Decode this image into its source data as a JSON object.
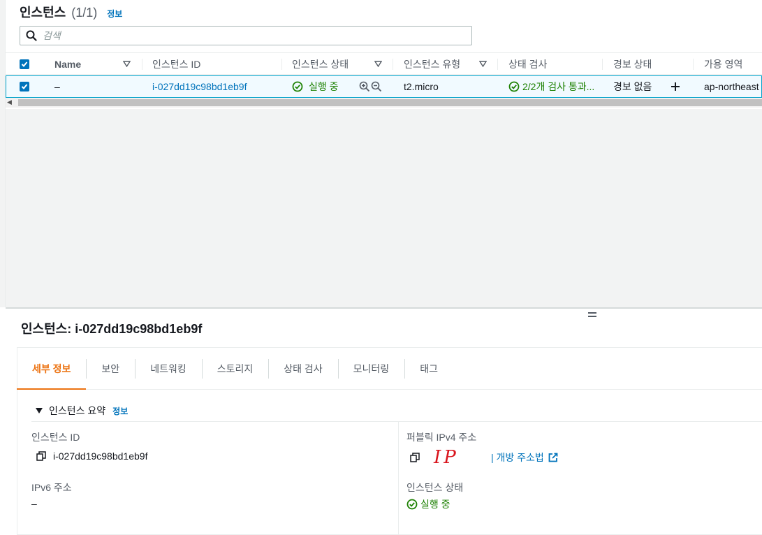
{
  "header": {
    "title": "인스턴스",
    "count": "(1/1)",
    "info": "정보"
  },
  "search": {
    "placeholder": "검색"
  },
  "table": {
    "columns": [
      "Name",
      "인스턴스 ID",
      "인스턴스 상태",
      "인스턴스 유형",
      "상태 검사",
      "경보 상태",
      "가용 영역"
    ],
    "row": {
      "name": "–",
      "instance_id": "i-027dd19c98bd1eb9f",
      "state": "실행 중",
      "type": "t2.micro",
      "status_check": "2/2개 검사 통과...",
      "alarm": "경보 없음",
      "az": "ap-northeast"
    }
  },
  "detail": {
    "title": "인스턴스: i-027dd19c98bd1eb9f",
    "tabs": [
      "세부 정보",
      "보안",
      "네트워킹",
      "스토리지",
      "상태 검사",
      "모니터링",
      "태그"
    ],
    "section_title": "인스턴스 요약",
    "section_info": "정보",
    "fields": {
      "instance_id_label": "인스턴스 ID",
      "instance_id_value": "i-027dd19c98bd1eb9f",
      "public_ip_label": "퍼블릭 IPv4 주소",
      "public_ip_value": "IP",
      "open_address": "| 개방 주소법",
      "ipv6_label": "IPv6 주소",
      "ipv6_value": "–",
      "state_label": "인스턴스 상태",
      "state_value": "실행 중"
    }
  },
  "colors": {
    "link": "#0073bb",
    "success": "#1d8102",
    "active_tab": "#ec7211",
    "annotation": "#d9141c"
  }
}
